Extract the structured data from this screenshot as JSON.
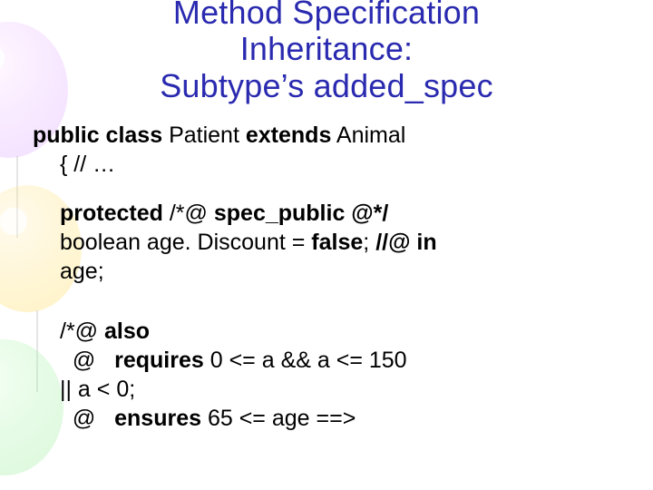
{
  "title": {
    "line1": "Method Specification",
    "line2": "Inheritance:",
    "line3": "Subtype’s added_spec"
  },
  "code": {
    "decl": {
      "kw_public_class": "public class",
      "classname": " Patient ",
      "kw_extends": "extends",
      "supertype": " Animal",
      "brace_comment": "{ // …"
    },
    "field": {
      "kw_protected": "protected",
      "annot_open": " /*@ ",
      "kw_spec_public": "spec_public",
      "annot_close": " @*/",
      "type_name": "boolean age. Discount = ",
      "kw_false": "false",
      "semi": "; ",
      "annot_in": "//@ in",
      "tail": "age;"
    },
    "spec": {
      "open": "/*@ ",
      "kw_also": "also",
      "at2": "  @   ",
      "kw_requires": "requires",
      "req_expr": " 0 <= a && a <= 150",
      "req_cont": "|| a < 0;",
      "at3": "  @   ",
      "kw_ensures": "ensures",
      "ens_expr": " 65 <= age ==>"
    }
  }
}
